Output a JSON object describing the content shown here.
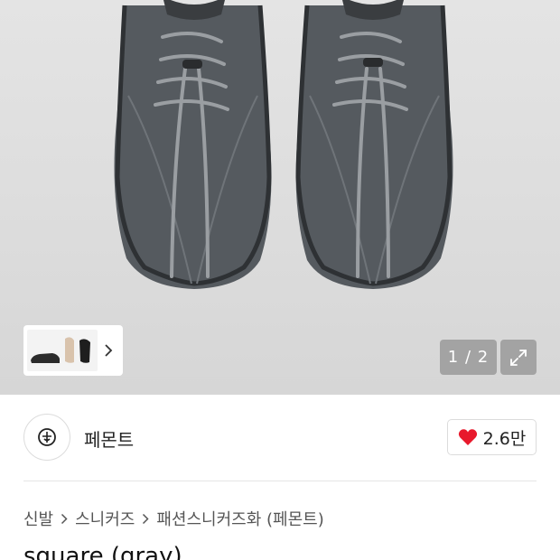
{
  "gallery": {
    "counter": "1 / 2",
    "icons": {
      "next": "chevron-right-icon",
      "expand": "expand-icon"
    }
  },
  "brand": {
    "name": "페몬트",
    "logo_icon": "brand-logo-icon"
  },
  "like": {
    "count": "2.6만",
    "icon": "heart-icon",
    "color": "#e8192c"
  },
  "breadcrumb": {
    "items": [
      "신발",
      "스니커즈",
      "패션스니커즈화 (페몬트)"
    ],
    "separator_icon": "chevron-right-icon"
  },
  "product": {
    "title": "square (gray)"
  }
}
